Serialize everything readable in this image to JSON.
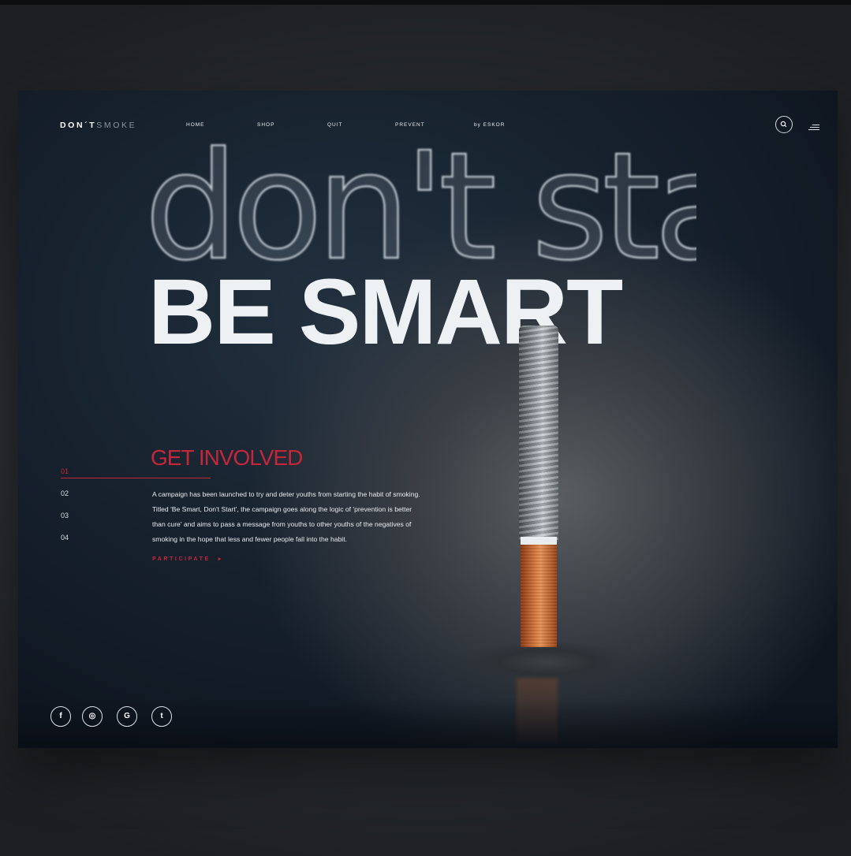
{
  "brand": {
    "logo_bold": "DON´T",
    "logo_light": "SMOKE"
  },
  "nav": {
    "items": [
      "HOME",
      "SHOP",
      "QUIT",
      "PREVENT",
      "by ESKOR"
    ]
  },
  "icons": {
    "search": "search-icon",
    "menu": "hamburger-menu-icon",
    "social": [
      "facebook-icon",
      "instagram-icon",
      "google-plus-icon",
      "twitter-icon"
    ]
  },
  "hero": {
    "smoke_line": "don't start",
    "headline": "BE SMART"
  },
  "sections": {
    "index": [
      "01",
      "02",
      "03",
      "04"
    ],
    "active_index": "01",
    "title": "GET INVOLVED",
    "body_lines": [
      "A campaign has been launched to try and deter youths from starting the habit of smoking.",
      "Titled 'Be Smart, Don't Start', the campaign goes along the logic of 'prevention is better",
      "than cure' and aims to pass a message from youths to other youths of the negatives of",
      "smoking in the hope that less and fewer people fall into the habit."
    ],
    "cta": "PARTICIPATE",
    "cta_arrow": "▸"
  },
  "social_glyphs": [
    "f",
    "◎",
    "G",
    "t"
  ],
  "colors": {
    "accent": "#c4273a",
    "text": "#eef1f4",
    "background": "#16202c"
  }
}
